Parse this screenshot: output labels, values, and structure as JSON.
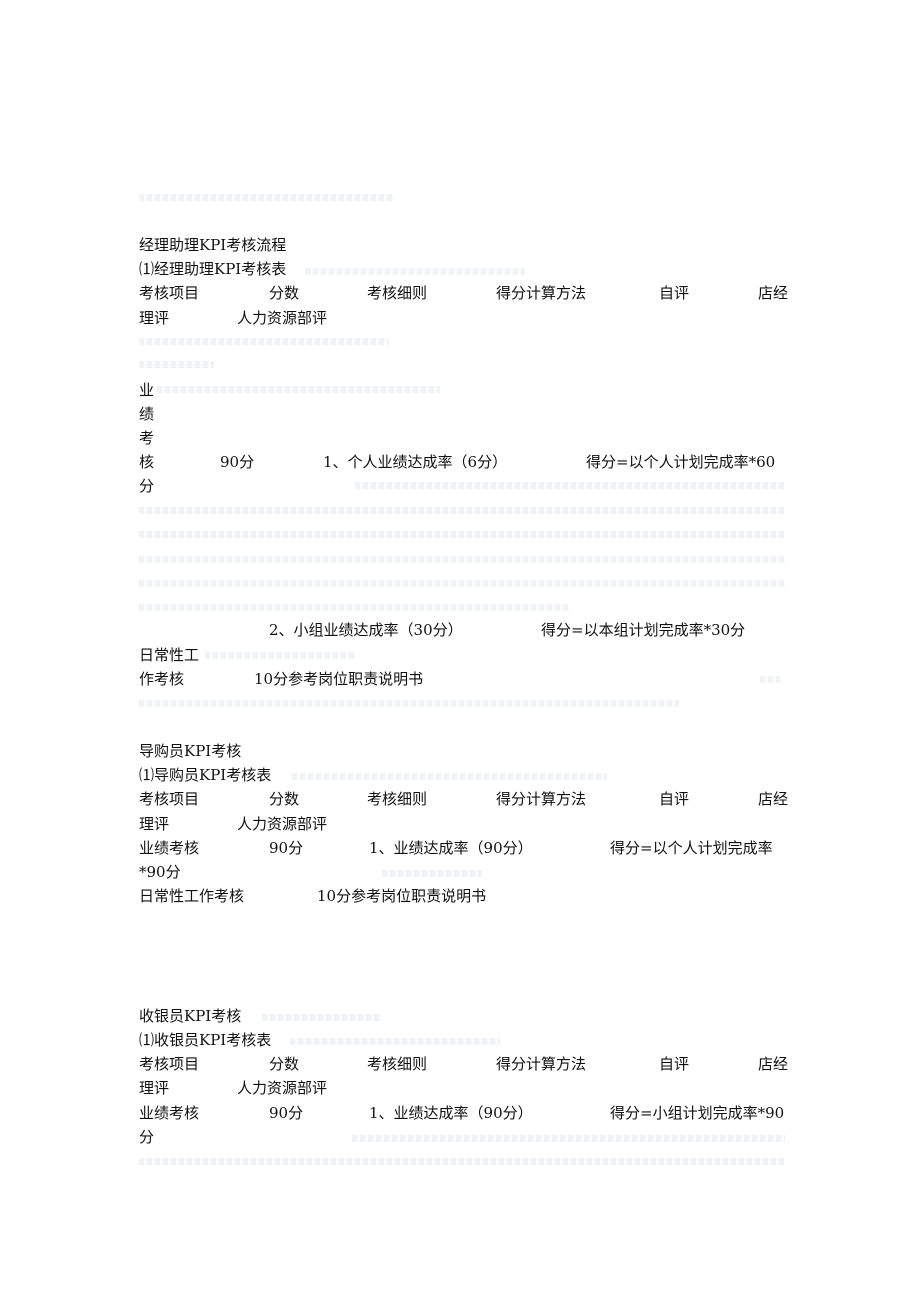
{
  "sections": [
    {
      "title": "经理助理KPI考核流程",
      "table_title": "⑴经理助理KPI考核表",
      "headers": [
        "考核项目",
        "分数",
        "考核细则",
        "得分计算方法",
        "自评",
        "店经",
        "理评",
        "人力资源部评"
      ],
      "rows": {
        "perf_vertical": [
          "业",
          "绩",
          "考",
          "核",
          "分"
        ],
        "perf_score": "90分",
        "perf_item1": "1、个人业绩达成率（6分）",
        "perf_calc1": "得分=以个人计划完成率*60",
        "perf_item2": "2、小组业绩达成率（30分）",
        "perf_calc2": "得分=以本组计划完成率*30分",
        "daily_label_a": "日常性工",
        "daily_label_b": "作考核",
        "daily_score_desc": "10分参考岗位职责说明书"
      }
    },
    {
      "title": "导购员KPI考核",
      "table_title": "⑴导购员KPI考核表",
      "headers": [
        "考核项目",
        "分数",
        "考核细则",
        "得分计算方法",
        "自评",
        "店经",
        "理评",
        "人力资源部评"
      ],
      "rows": {
        "perf_label": "业绩考核",
        "perf_score": "90分",
        "perf_item": "1、业绩达成率（90分）",
        "perf_calc": "得分=以个人计划完成率",
        "perf_calc_cont": "*90分",
        "daily_label": "日常性工作考核",
        "daily_score_desc": "10分参考岗位职责说明书"
      }
    },
    {
      "title": "收银员KPI考核",
      "table_title": "⑴收银员KPI考核表",
      "headers": [
        "考核项目",
        "分数",
        "考核细则",
        "得分计算方法",
        "自评",
        "店经",
        "理评",
        "人力资源部评"
      ],
      "rows": {
        "perf_label": "业绩考核",
        "perf_score": "90分",
        "perf_item": "1、业绩达成率（90分）",
        "perf_calc": "得分=小组计划完成率*90",
        "perf_calc_cont": "分"
      }
    }
  ]
}
